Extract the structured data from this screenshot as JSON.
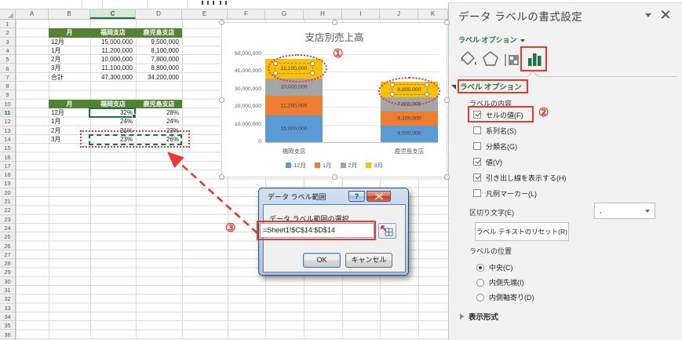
{
  "sheet": {
    "column_letters": [
      "A",
      "B",
      "C",
      "D",
      "E",
      "F",
      "G",
      "H",
      "I",
      "J",
      "K"
    ],
    "selected_column": "C",
    "row_count": 36,
    "selected_row": 11,
    "sales_table": {
      "headers": [
        "月",
        "福岡支店",
        "鹿児島支店"
      ],
      "rows": [
        {
          "month": "12月",
          "fukuoka": "15,000,000",
          "kagoshima": "9,500,000"
        },
        {
          "month": "1月",
          "fukuoka": "11,200,000",
          "kagoshima": "8,100,000"
        },
        {
          "month": "2月",
          "fukuoka": "10,000,000",
          "kagoshima": "7,800,000"
        },
        {
          "month": "3月",
          "fukuoka": "11,100,000",
          "kagoshima": "8,800,000"
        },
        {
          "month": "合計",
          "fukuoka": "47,300,000",
          "kagoshima": "34,200,000"
        }
      ]
    },
    "percent_table": {
      "headers": [
        "月",
        "福岡支店",
        "鹿児島支店"
      ],
      "rows": [
        {
          "month": "12月",
          "fukuoka": "32%",
          "kagoshima": "28%"
        },
        {
          "month": "1月",
          "fukuoka": "24%",
          "kagoshima": "24%"
        },
        {
          "month": "2月",
          "fukuoka": "21%",
          "kagoshima": "23%"
        },
        {
          "month": "3月",
          "fukuoka": "23%",
          "kagoshima": "26%"
        }
      ]
    }
  },
  "chart_data": {
    "type": "bar",
    "stacked": true,
    "title": "支店別売上高",
    "categories": [
      "福岡支店",
      "鹿児島支店"
    ],
    "series": [
      {
        "name": "12月",
        "color": "#5B9BD5",
        "values": [
          15000000,
          9500000
        ],
        "labels": [
          "15,000,000",
          "9,500,000"
        ]
      },
      {
        "name": "1月",
        "color": "#ED7D31",
        "values": [
          11200000,
          8100000
        ],
        "labels": [
          "11,200,000",
          "8,100,000"
        ]
      },
      {
        "name": "2月",
        "color": "#A5A5A5",
        "values": [
          10000000,
          7800000
        ],
        "labels": [
          "10,000,000",
          "7,800,000"
        ]
      },
      {
        "name": "3月",
        "color": "#FFC000",
        "values": [
          11100000,
          8800000
        ],
        "labels": [
          "11,100,000",
          "8,800,000"
        ],
        "selected": true
      }
    ],
    "ylim": [
      0,
      50000000
    ],
    "ytick_step": 10000000,
    "yticks": [
      "0",
      "10,000,000",
      "20,000,000",
      "30,000,000",
      "40,000,000",
      "50,000,000"
    ],
    "xlabel": "",
    "ylabel": "",
    "legend_position": "bottom",
    "grid": true
  },
  "dialog": {
    "title": "データ ラベル範囲",
    "help_label": "?",
    "select_label": "データ ラベル範囲の選択",
    "range_value": "=Sheet1!$C$14:$D$14",
    "ok_label": "OK",
    "cancel_label": "キャンセル"
  },
  "panel": {
    "title": "データ ラベルの書式設定",
    "tab": "ラベル オプション",
    "section": "ラベル オプション",
    "content_group": "ラベルの内容",
    "checkboxes": [
      {
        "label": "セルの値(F)",
        "checked": true
      },
      {
        "label": "系列名(S)",
        "checked": false
      },
      {
        "label": "分類名(G)",
        "checked": false
      },
      {
        "label": "値(V)",
        "checked": true
      },
      {
        "label": "引き出し線を表示する(H)",
        "checked": true
      },
      {
        "label": "凡例マーカー(L)",
        "checked": false
      }
    ],
    "separator_label": "区切り文字(E)",
    "separator_value": ",",
    "reset_button": "ラベル テキストのリセット(R)",
    "position_group": "ラベルの位置",
    "radios": [
      {
        "label": "中央(C)",
        "selected": true
      },
      {
        "label": "内側先端(I)",
        "selected": false
      },
      {
        "label": "内側軸寄り(D)",
        "selected": false
      }
    ],
    "collapsed_section": "表示形式"
  },
  "annotations": {
    "c1": "①",
    "c2": "②",
    "c3": "③"
  }
}
